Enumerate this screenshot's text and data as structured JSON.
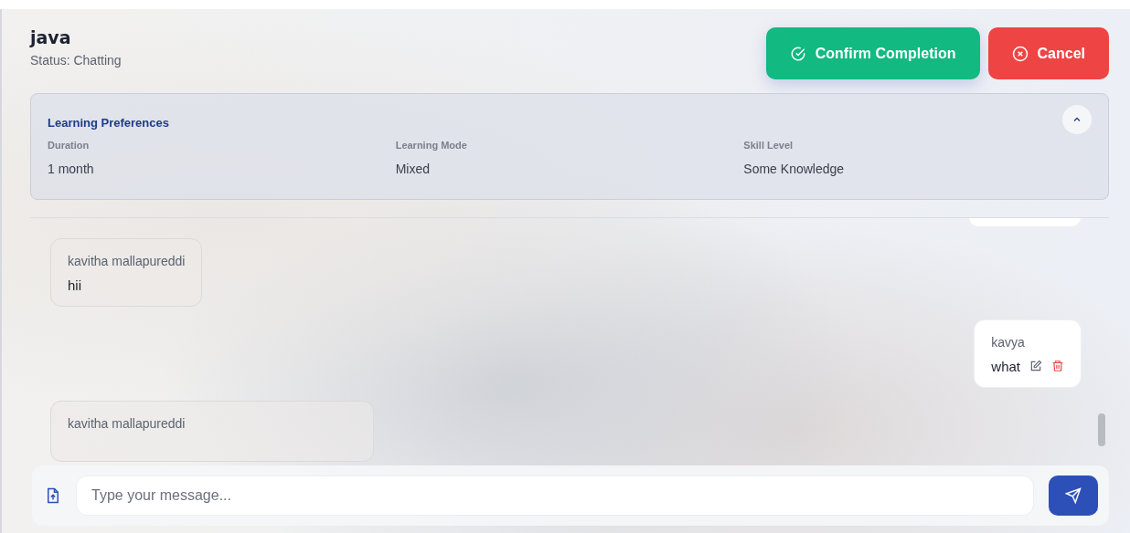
{
  "header": {
    "title": "java",
    "status": "Status: Chatting"
  },
  "actions": [
    {
      "kind": "confirm",
      "label": "Confirm Completion"
    },
    {
      "kind": "cancel",
      "label": "Cancel"
    }
  ],
  "preferences": {
    "title": "Learning Preferences",
    "expanded": true,
    "fields": [
      {
        "label": "Duration",
        "value": "1 month"
      },
      {
        "label": "Learning Mode",
        "value": "Mixed"
      },
      {
        "label": "Skill Level",
        "value": "Some Knowledge"
      }
    ]
  },
  "messages": [
    {
      "kind": "clipped"
    },
    {
      "kind": "received",
      "sender": "kavitha mallapureddi",
      "text": "hii"
    },
    {
      "kind": "sent",
      "sender": "kavya",
      "text": "what"
    },
    {
      "kind": "attachment",
      "sender": "kavitha mallapureddi"
    }
  ],
  "composer": {
    "placeholder": "Type your message..."
  }
}
